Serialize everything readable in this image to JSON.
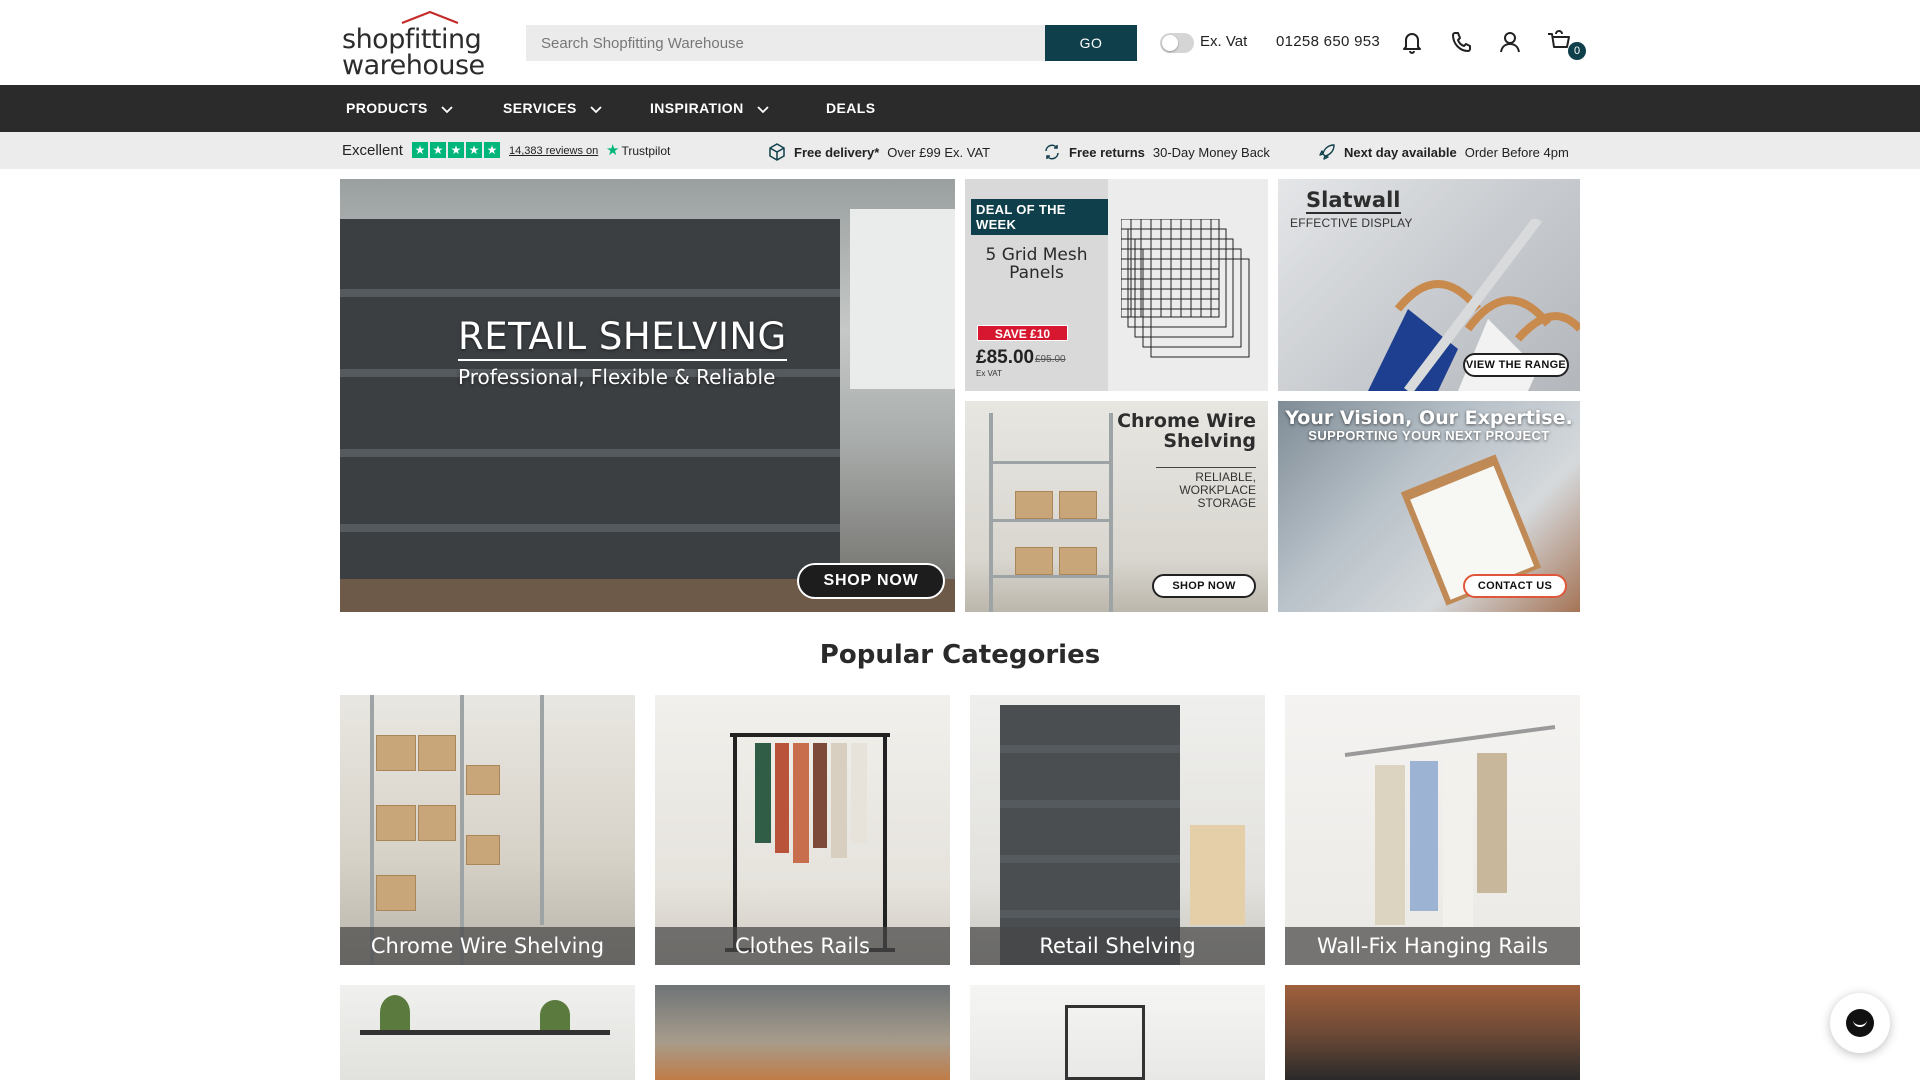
{
  "header": {
    "logo_line1": "shopfitting",
    "logo_line2": "warehouse",
    "search_placeholder": "Search Shopfitting Warehouse",
    "search_button": "GO",
    "vat_label": "Ex. Vat",
    "phone": "01258 650 953",
    "cart_count": "0"
  },
  "nav": {
    "items": [
      {
        "label": "PRODUCTS",
        "has_dropdown": true
      },
      {
        "label": "SERVICES",
        "has_dropdown": true
      },
      {
        "label": "INSPIRATION",
        "has_dropdown": true
      },
      {
        "label": "DEALS",
        "has_dropdown": false
      }
    ]
  },
  "usp": {
    "trustpilot_rating": "Excellent",
    "trustpilot_reviews": "14,383 reviews on",
    "trustpilot_brand": "Trustpilot",
    "delivery_bold": "Free delivery*",
    "delivery_text": "Over £99 Ex. VAT",
    "returns_bold": "Free returns",
    "returns_text": "30-Day Money Back",
    "nextday_bold": "Next day available",
    "nextday_text": "Order Before 4pm"
  },
  "hero": {
    "title": "RETAIL SHELVING",
    "subtitle": "Professional, Flexible & Reliable",
    "button": "SHOP NOW"
  },
  "deal": {
    "badge": "DEAL OF THE WEEK",
    "title": "5 Grid Mesh Panels",
    "save": "SAVE £10",
    "price": "£85.00",
    "was_price": "£95.00",
    "vat_note": "Ex VAT"
  },
  "slatwall": {
    "title": "Slatwall",
    "subtitle": "EFFECTIVE DISPLAY",
    "button": "VIEW THE RANGE"
  },
  "chrome_wire": {
    "title_line1": "Chrome Wire",
    "title_line2": "Shelving",
    "sub_line1": "RELIABLE,",
    "sub_line2": "WORKPLACE",
    "sub_line3": "STORAGE",
    "button": "SHOP NOW"
  },
  "vision": {
    "title": "Your Vision, Our Expertise.",
    "subtitle": "SUPPORTING YOUR NEXT PROJECT",
    "button": "CONTACT US"
  },
  "popular": {
    "heading": "Popular Categories",
    "categories": [
      {
        "label": "Chrome Wire Shelving"
      },
      {
        "label": "Clothes Rails"
      },
      {
        "label": "Retail Shelving"
      },
      {
        "label": "Wall-Fix Hanging Rails"
      }
    ]
  },
  "colors": {
    "brand_teal": "#0e3f4a",
    "nav_bg": "#2b2b2b",
    "usp_bg": "#ececec",
    "trustpilot_green": "#00b67a",
    "sale_red": "#d7172f"
  }
}
